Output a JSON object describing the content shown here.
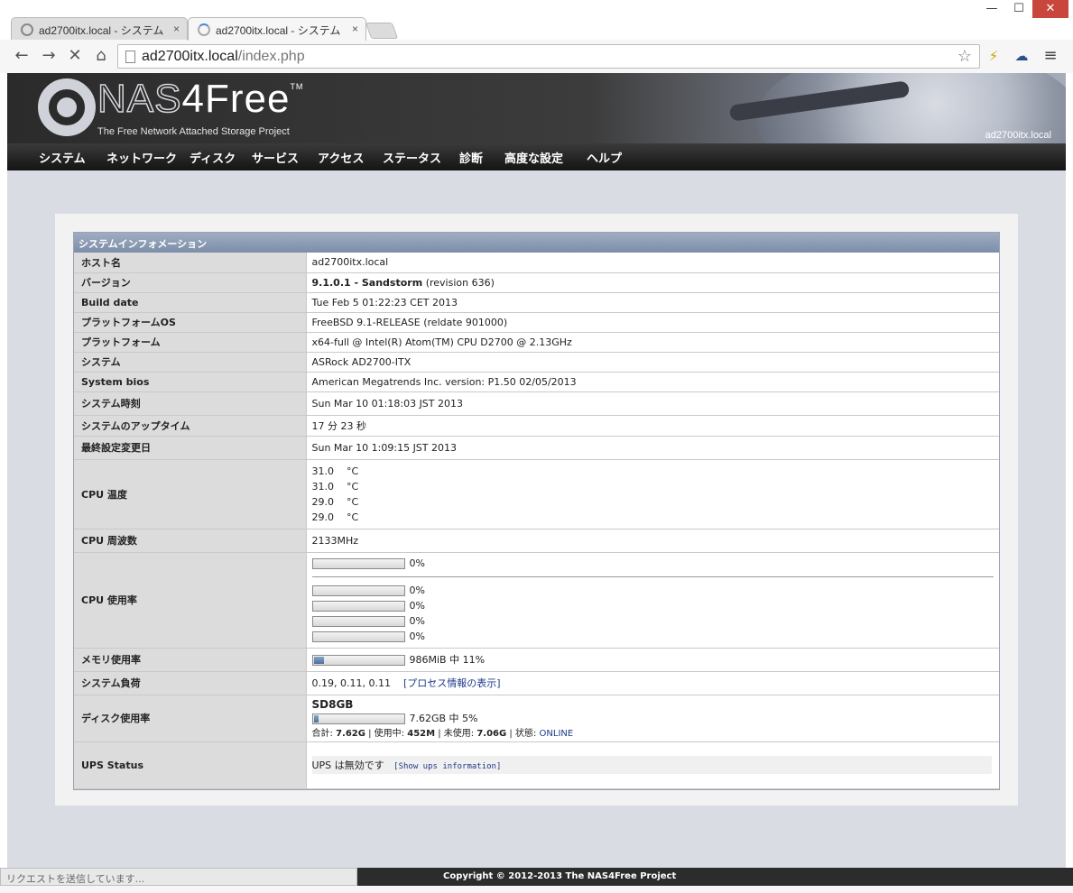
{
  "browser": {
    "tabs": [
      {
        "title": "ad2700itx.local - システム",
        "active": false
      },
      {
        "title": "ad2700itx.local - システム",
        "active": true
      }
    ],
    "tab_close": "×",
    "url_host": "ad2700itx.local",
    "url_path": "/index.php",
    "window_controls": {
      "minimize": "—",
      "maximize": "☐",
      "close": "✕"
    }
  },
  "header": {
    "logo_nas": "NAS",
    "logo_free": "4Free",
    "logo_tm": "TM",
    "tagline": "The Free Network Attached Storage Project",
    "hostname_label": "ad2700itx.local"
  },
  "menu": [
    "システム",
    "ネットワーク",
    "ディスク",
    "サービス",
    "アクセス",
    "ステータス",
    "診断",
    "高度な設定",
    "ヘルプ"
  ],
  "system_info": {
    "title": "システムインフォメーション",
    "rows": {
      "hostname": {
        "label": "ホスト名",
        "value": "ad2700itx.local"
      },
      "version": {
        "label": "バージョン",
        "value_bold": "9.1.0.1 - Sandstorm",
        "value_rest": "(revision 636)"
      },
      "build_date": {
        "label": "Build date",
        "value": "Tue Feb 5 01:22:23 CET 2013"
      },
      "platform_os": {
        "label": "プラットフォームOS",
        "value": "FreeBSD 9.1-RELEASE (reldate 901000)"
      },
      "platform": {
        "label": "プラットフォーム",
        "value": "x64-full @ Intel(R) Atom(TM) CPU D2700 @ 2.13GHz"
      },
      "system": {
        "label": "システム",
        "value": "ASRock AD2700-ITX"
      },
      "bios": {
        "label": "System bios",
        "value": "American Megatrends Inc. version: P1.50 02/05/2013"
      },
      "time": {
        "label": "システム時刻",
        "value": "Sun Mar 10 01:18:03 JST 2013"
      },
      "uptime": {
        "label": "システムのアップタイム",
        "value": "17 分 23 秒"
      },
      "last_config": {
        "label": "最終設定変更日",
        "value": "Sun Mar 10 1:09:15 JST 2013"
      },
      "cpu_temp": {
        "label": "CPU 温度",
        "values": [
          "31.0",
          "31.0",
          "29.0",
          "29.0"
        ],
        "unit": "°C"
      },
      "cpu_freq": {
        "label": "CPU 周波数",
        "value": "2133MHz"
      },
      "cpu_usage": {
        "label": "CPU 使用率",
        "total": "0%",
        "total_fraction": 0,
        "cores": [
          {
            "text": "0%",
            "fraction": 0
          },
          {
            "text": "0%",
            "fraction": 0
          },
          {
            "text": "0%",
            "fraction": 0
          },
          {
            "text": "0%",
            "fraction": 0
          }
        ]
      },
      "memory": {
        "label": "メモリ使用率",
        "text": "986MiB 中 11%",
        "fraction": 0.11
      },
      "load": {
        "label": "システム負荷",
        "value": "0.19, 0.11, 0.11",
        "link": "[プロセス情報の表示]"
      },
      "disk": {
        "label": "ディスク使用率",
        "name": "SD8GB",
        "text": "7.62GB 中 5%",
        "fraction": 0.05,
        "total_label": "合計: ",
        "total": "7.62G",
        "used_label": " | 使用中: ",
        "used": "452M",
        "free_label": " | 未使用: ",
        "free": "7.06G",
        "state_label": " | 状態: ",
        "state": "ONLINE"
      },
      "ups": {
        "label": "UPS Status",
        "value": "UPS は無効です",
        "link": "[Show ups information]"
      }
    }
  },
  "status": {
    "loading": "リクエストを送信しています...",
    "copyright": "Copyright © 2012-2013 The NAS4Free Project"
  }
}
